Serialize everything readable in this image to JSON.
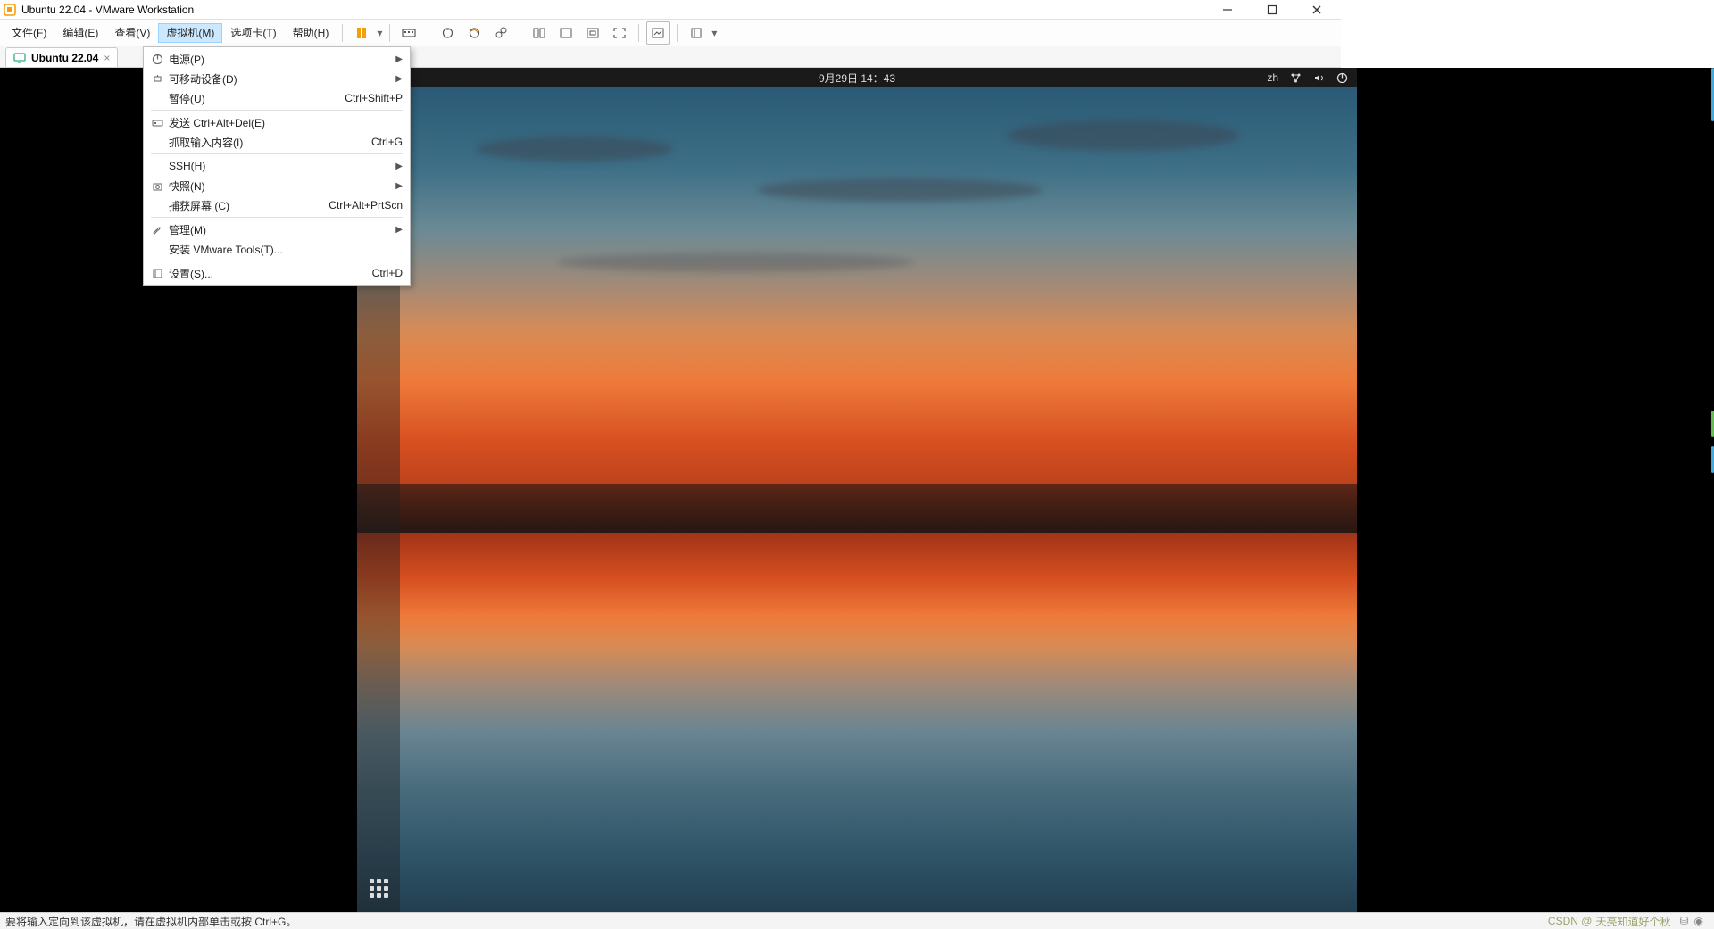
{
  "title": "Ubuntu 22.04 - VMware Workstation",
  "menubar": [
    "文件(F)",
    "编辑(E)",
    "查看(V)",
    "虚拟机(M)",
    "选项卡(T)",
    "帮助(H)"
  ],
  "active_menu_index": 3,
  "dropdown": {
    "items": [
      {
        "icon": "power",
        "label": "电源(P)",
        "sub": true
      },
      {
        "icon": "usb",
        "label": "可移动设备(D)",
        "sub": true
      },
      {
        "icon": "",
        "label": "暂停(U)",
        "shortcut": "Ctrl+Shift+P"
      },
      {
        "sep": true
      },
      {
        "icon": "send",
        "label": "发送 Ctrl+Alt+Del(E)"
      },
      {
        "icon": "",
        "label": "抓取输入内容(I)",
        "shortcut": "Ctrl+G"
      },
      {
        "sep": true
      },
      {
        "icon": "",
        "label": "SSH(H)",
        "sub": true
      },
      {
        "icon": "snapshot",
        "label": "快照(N)",
        "sub": true
      },
      {
        "icon": "",
        "label": "捕获屏幕 (C)",
        "shortcut": "Ctrl+Alt+PrtScn"
      },
      {
        "sep": true
      },
      {
        "icon": "wrench",
        "label": "管理(M)",
        "sub": true
      },
      {
        "icon": "",
        "label": "安装 VMware Tools(T)..."
      },
      {
        "sep": true
      },
      {
        "icon": "settings",
        "label": "设置(S)...",
        "shortcut": "Ctrl+D"
      }
    ]
  },
  "tab": {
    "label": "Ubuntu 22.04"
  },
  "guest": {
    "clock": "9月29日  14：43",
    "input": "zh",
    "dock_icons": [
      {
        "name": "files-icon",
        "bg": "#2e6fb5"
      },
      {
        "name": "document-icon",
        "bg": "#2e6fb5"
      },
      {
        "name": "software-icon",
        "bg": "#e95420"
      },
      {
        "name": "help-icon",
        "bg": "#2d6fd2"
      },
      {
        "name": "trash-icon",
        "bg": "#d9d4c8"
      }
    ]
  },
  "statusbar": {
    "text": "要将输入定向到该虚拟机，请在虚拟机内部单击或按 Ctrl+G。",
    "watermark_prefix": "CSDN @",
    "watermark_name": "天亮知道好个秋"
  }
}
